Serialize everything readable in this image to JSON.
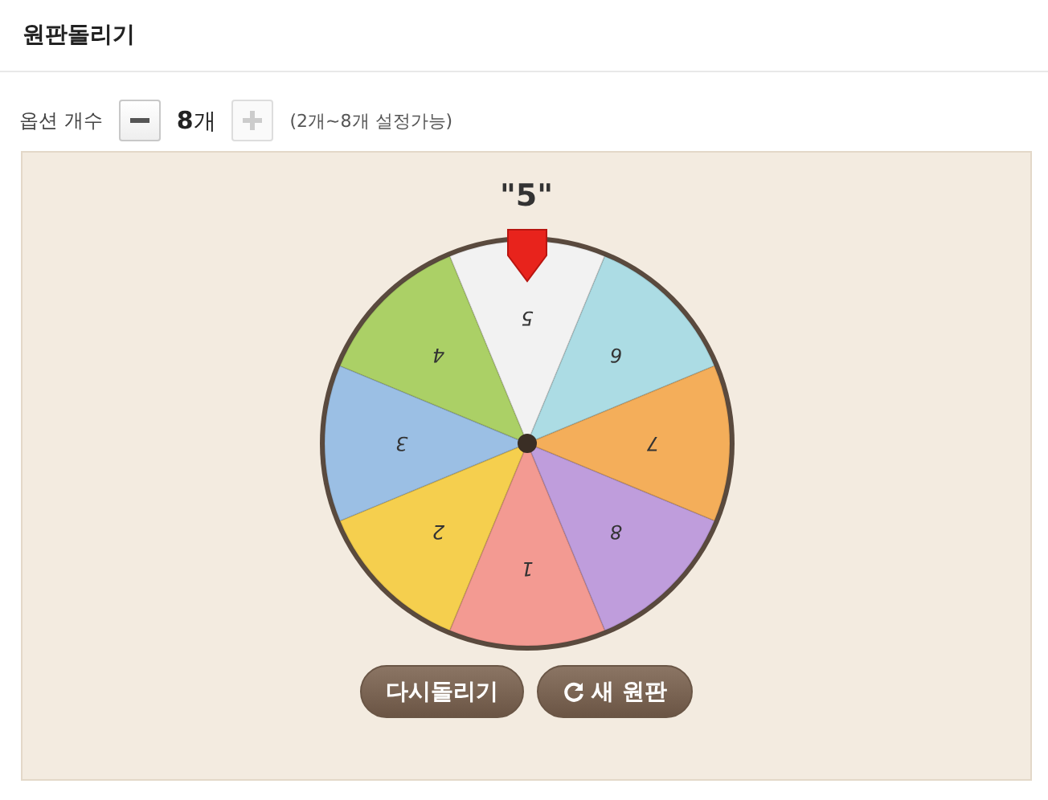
{
  "title": "원판돌리기",
  "options": {
    "label": "옵션 개수",
    "minus": {
      "disabled": false
    },
    "count": "**8**개",
    "plus": {
      "disabled": true
    },
    "hint": "(2개~8개 설정가능)"
  },
  "result": "\"5\"",
  "segments": [
    {
      "label": "5",
      "color": "#f2f2f2"
    },
    {
      "label": "6",
      "color": "#acdce4"
    },
    {
      "label": "7",
      "color": "#f4ae5a"
    },
    {
      "label": "8",
      "color": "#bf9ddc"
    },
    {
      "label": "1",
      "color": "#f39a92"
    },
    {
      "label": "2",
      "color": "#f5cf4e"
    },
    {
      "label": "3",
      "color": "#9bbfe4"
    },
    {
      "label": "4",
      "color": "#abd066"
    }
  ],
  "buttons": [
    {
      "label": "다시돌리기",
      "kind": "plain"
    },
    {
      "label": "새 원판",
      "kind": "refresh"
    }
  ]
}
